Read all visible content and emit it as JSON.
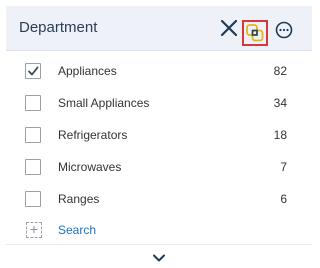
{
  "panel": {
    "title": "Department",
    "icons": {
      "close": "close-icon",
      "overlap": "overlap-squares-icon",
      "more": "more-options-icon",
      "expand": "chevron-down-icon"
    },
    "colors": {
      "header_bg": "#eef2f8",
      "title": "#2c3e57",
      "highlight": "#d9363e",
      "overlap_icon": "#e2b719",
      "link": "#1a73c8"
    }
  },
  "items": [
    {
      "label": "Appliances",
      "count": "82",
      "checked": true
    },
    {
      "label": "Small Appliances",
      "count": "34",
      "checked": false
    },
    {
      "label": "Refrigerators",
      "count": "18",
      "checked": false
    },
    {
      "label": "Microwaves",
      "count": "7",
      "checked": false
    },
    {
      "label": "Ranges",
      "count": "6",
      "checked": false
    }
  ],
  "search": {
    "label": "Search"
  }
}
